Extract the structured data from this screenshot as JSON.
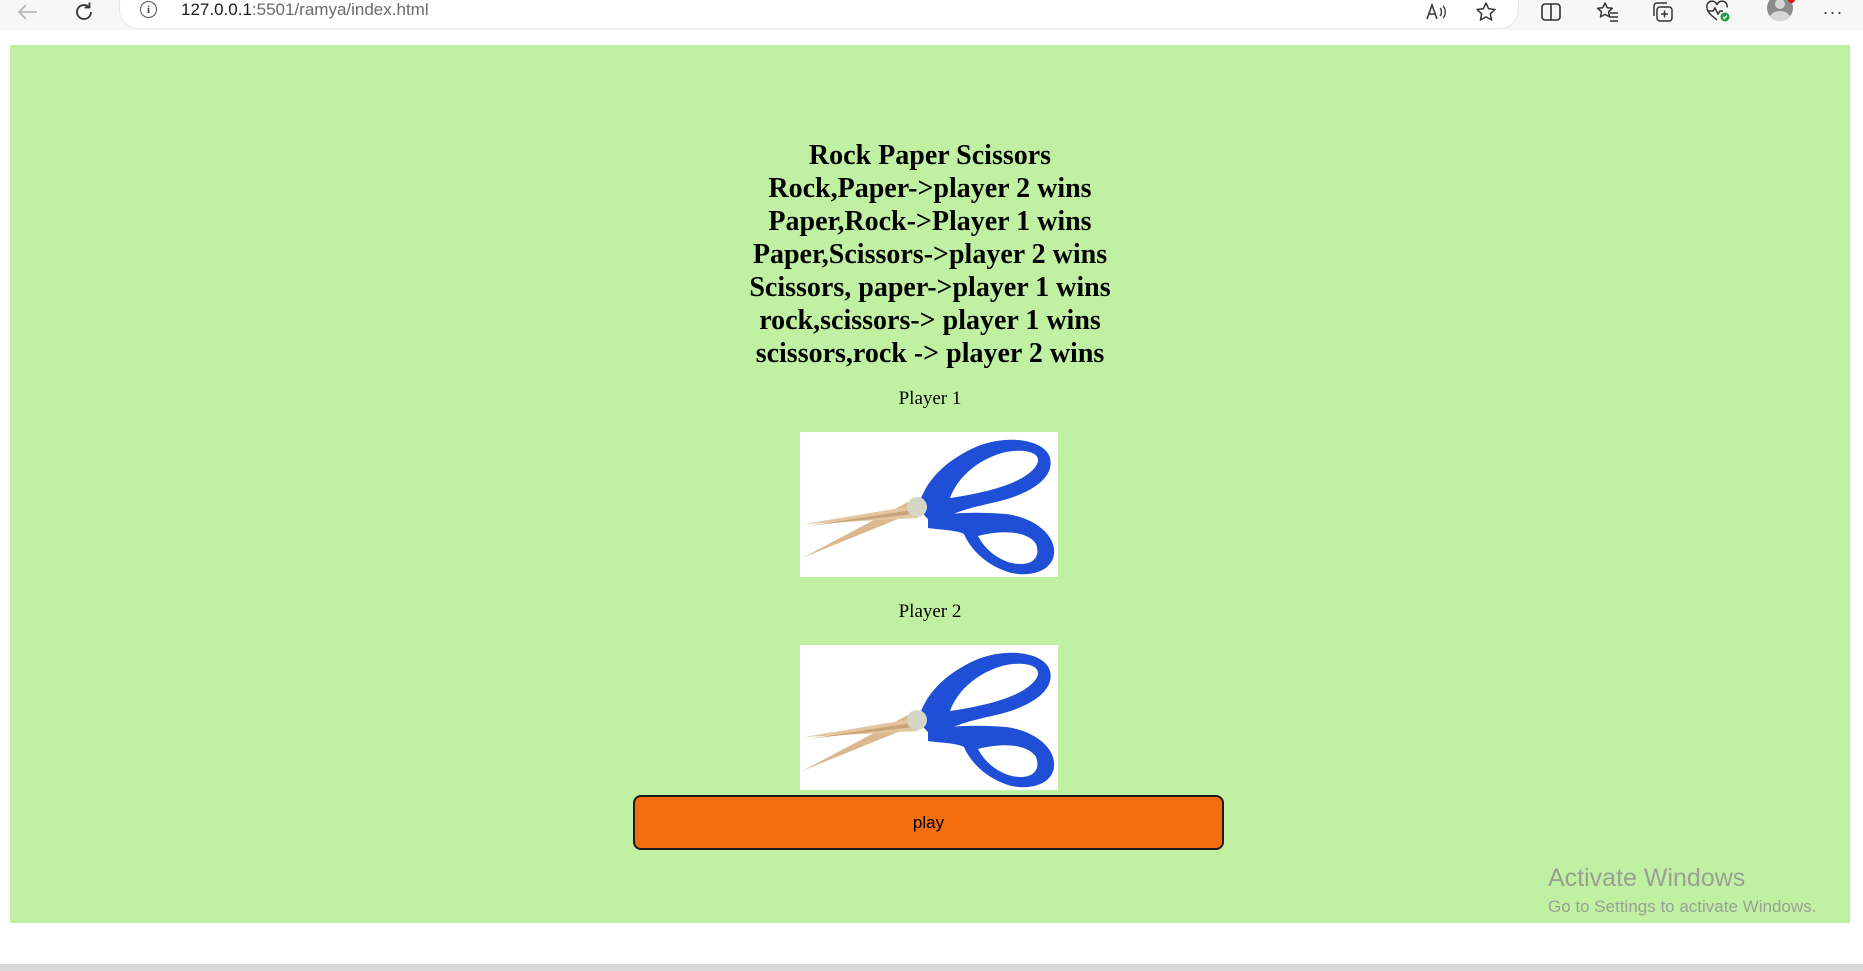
{
  "browser": {
    "url_host": "127.0.0.1",
    "url_rest": ":5501/ramya/index.html",
    "toolbar_icons": [
      "back-arrow-icon",
      "refresh-icon",
      "info-icon",
      "read-aloud-icon",
      "star-icon",
      "split-screen-icon",
      "favorites-icon",
      "collections-icon",
      "performance-icon",
      "profile-avatar",
      "more-icon"
    ]
  },
  "page": {
    "background": "#c0f1a3",
    "rules": [
      "Rock Paper Scissors",
      "Rock,Paper->player 2 wins",
      "Paper,Rock->Player 1 wins",
      "Paper,Scissors->player 2 wins",
      "Scissors, paper->player 1 wins",
      "rock,scissors-> player 1 wins",
      "scissors,rock -> player 2 wins"
    ],
    "player1_label": "Player 1",
    "player2_label": "Player 2",
    "player1_choice": "scissors",
    "player2_choice": "scissors",
    "play_button_label": "play",
    "play_button_color": "#f46d0e"
  },
  "watermark": {
    "title": "Activate Windows",
    "subtitle": "Go to Settings to activate Windows."
  }
}
